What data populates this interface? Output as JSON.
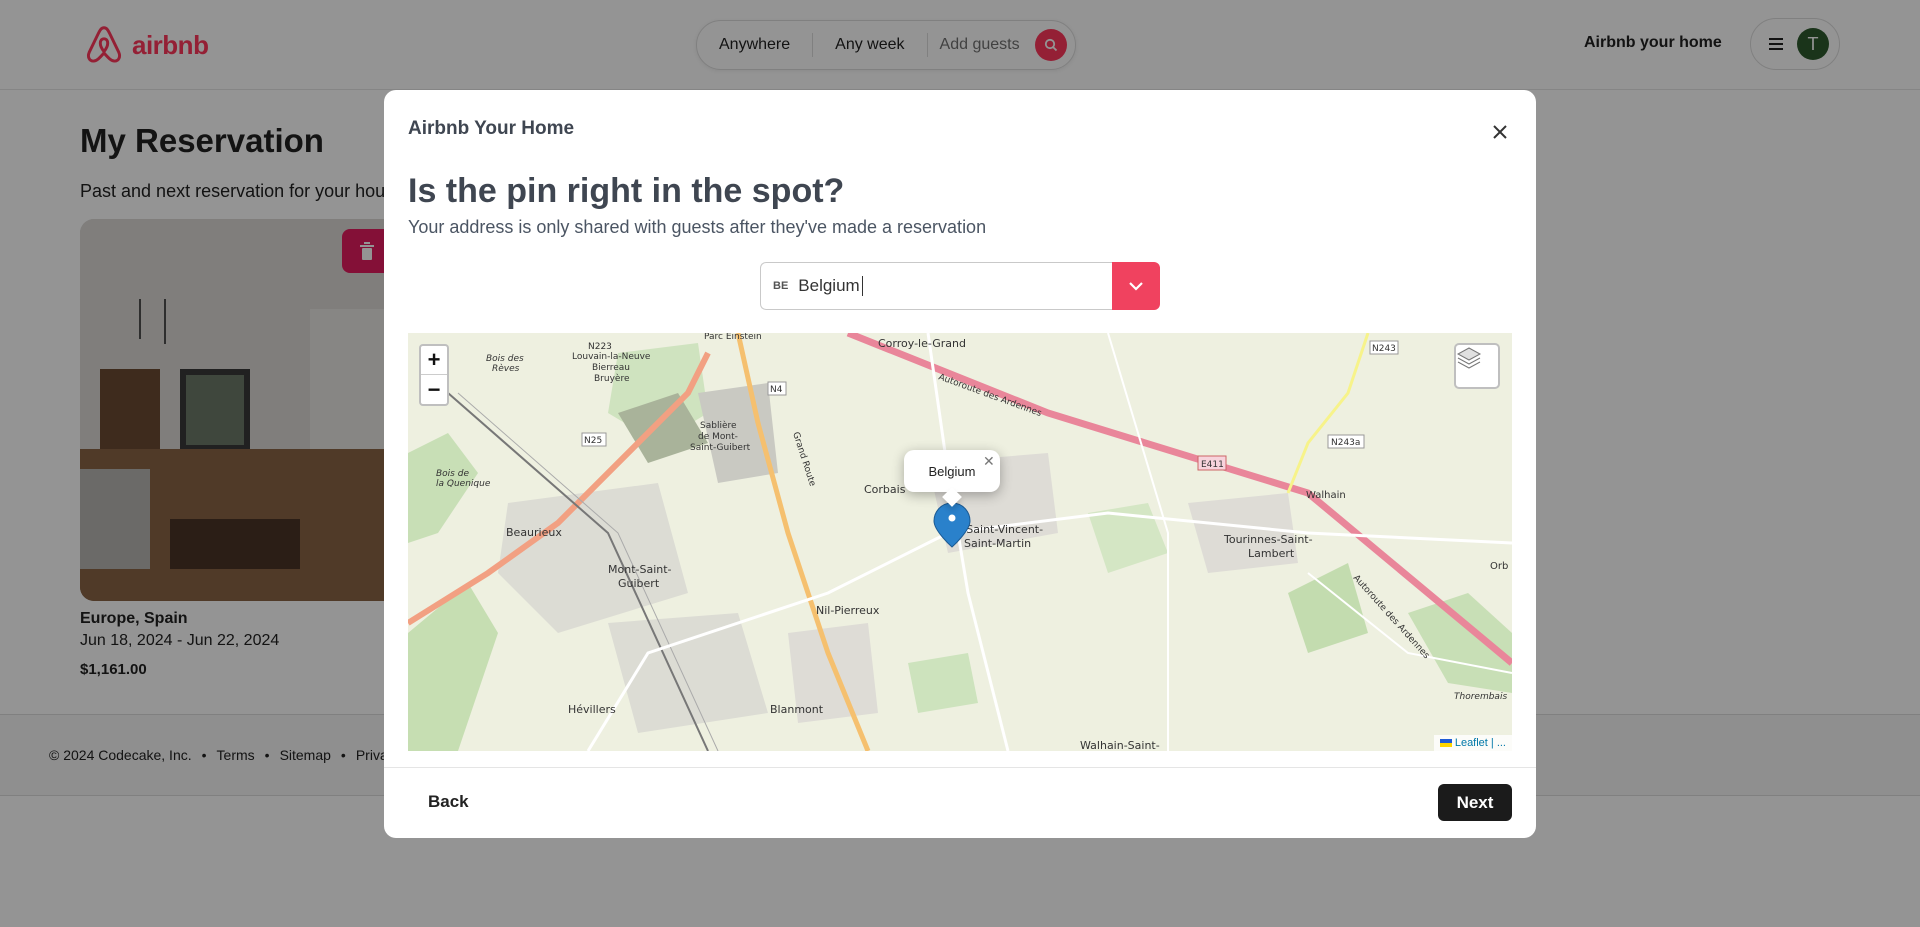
{
  "header": {
    "logo_text": "airbnb",
    "search": {
      "where": "Anywhere",
      "when": "Any week",
      "guests": "Add guests"
    },
    "host_link": "Airbnb your home",
    "avatar_initial": "T"
  },
  "page": {
    "title": "My Reservation",
    "subtitle": "Past and next reservation for your house",
    "card": {
      "location": "Europe, Spain",
      "dates": "Jun 18, 2024 - Jun 22, 2024",
      "price": "$1,161.00"
    }
  },
  "footer": {
    "items": [
      "© 2024 Codecake, Inc.",
      "•",
      "Terms",
      "•",
      "Sitemap",
      "•",
      "Privacy"
    ]
  },
  "modal": {
    "title": "Airbnb Your Home",
    "heading": "Is the pin right in the spot?",
    "subheading": "Your address is only shared with guests after they've made a reservation",
    "country": {
      "flag_code": "BE",
      "value": "Belgium"
    },
    "map": {
      "popup_text": "Belgium",
      "zoom_in": "+",
      "zoom_out": "−",
      "attribution": "Leaflet | ...",
      "labels": [
        "Corroy-le-Grand",
        "Corbais",
        "Nil-Saint-Vincent-Saint-Martin",
        "Mont-Saint-Guibert",
        "Beaurieux",
        "Nil-Pierreux",
        "Tourinnes-Saint-Lambert",
        "Walhain",
        "Hévillers",
        "Blanmont",
        "Walhain-Saint-",
        "Sablière de Mont-Saint-Guibert",
        "Parc Einstein",
        "N223 Louvain-la-Neuve Bierreau Bruyère",
        "N4",
        "N25",
        "E411",
        "N243",
        "N243a",
        "Grand Route",
        "Autoroute des Ardennes",
        "Bois des Rèves",
        "Bois de la Quenique",
        "Thorembais",
        "Orb"
      ]
    },
    "back_label": "Back",
    "next_label": "Next"
  },
  "colors": {
    "brand": "#ff385c",
    "next_bg": "#1b1b1b",
    "pin": "#2a81cb"
  }
}
